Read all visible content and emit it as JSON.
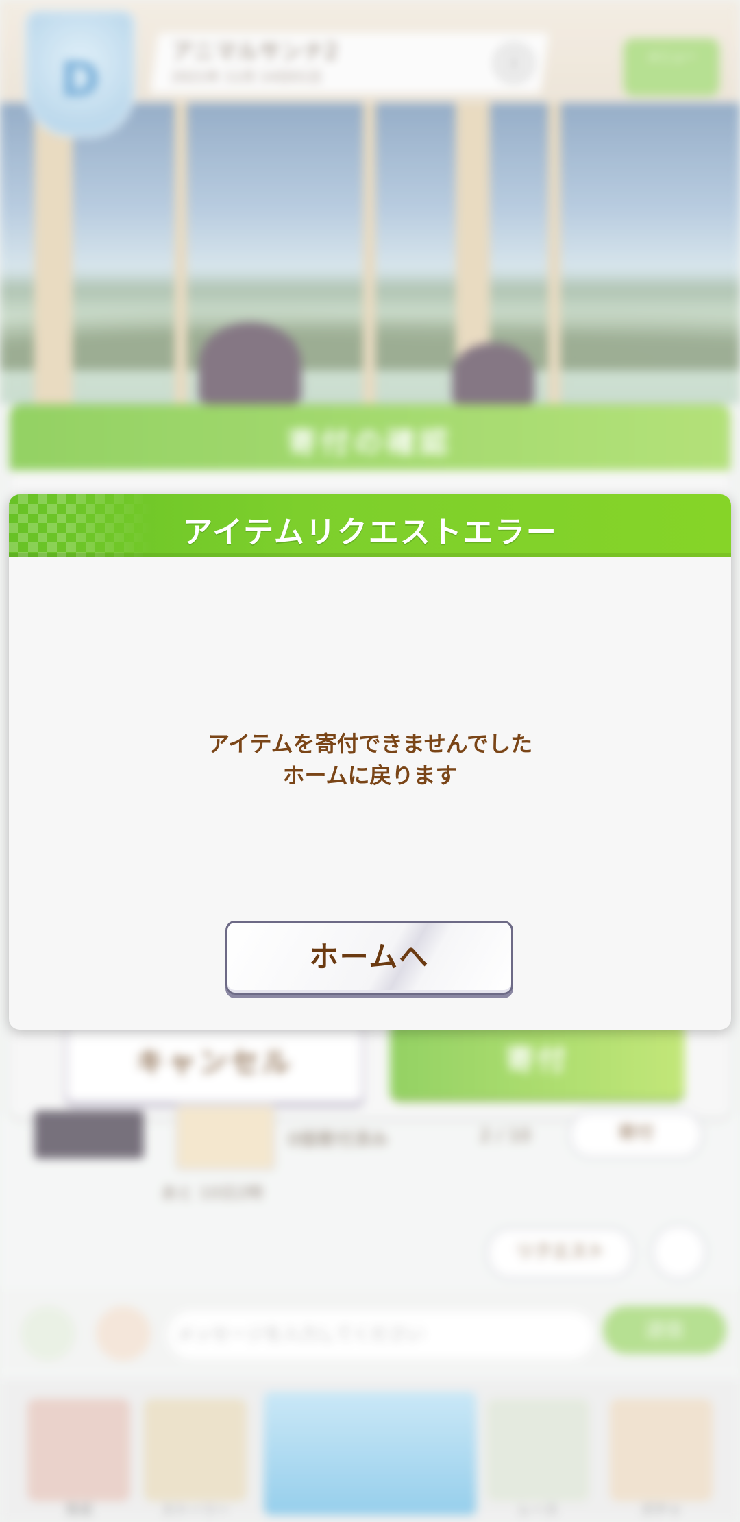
{
  "header": {
    "name": "アニマルサンナ2",
    "subtitle": "2021年 11月 14日01日"
  },
  "menu_button": {
    "label": "メニュー"
  },
  "background_dialog": {
    "title": "寄付の確認",
    "cancel_label": "キャンセル",
    "donate_label": "寄付"
  },
  "background_list": {
    "item_name": "0個寄付済み",
    "item_count": "2 / 10",
    "row_button": "寄付",
    "item_time": "あと 10日2時",
    "request_label": "リクエスト"
  },
  "chat": {
    "placeholder": "メッセージを入力してください",
    "send_label": "送信"
  },
  "nav": {
    "items": [
      "育成",
      "ストーリー",
      "ホーム",
      "レース",
      "ガチャ"
    ]
  },
  "error_dialog": {
    "title": "アイテムリクエストエラー",
    "message_line1": "アイテムを寄付できませんでした",
    "message_line2": "ホームに戻ります",
    "home_button_label": "ホームへ"
  },
  "colors": {
    "header_green": "#7dcf2c",
    "message_brown": "#7a4517",
    "button_text_brown": "#6b3a11",
    "button_border": "#6d6a86"
  }
}
